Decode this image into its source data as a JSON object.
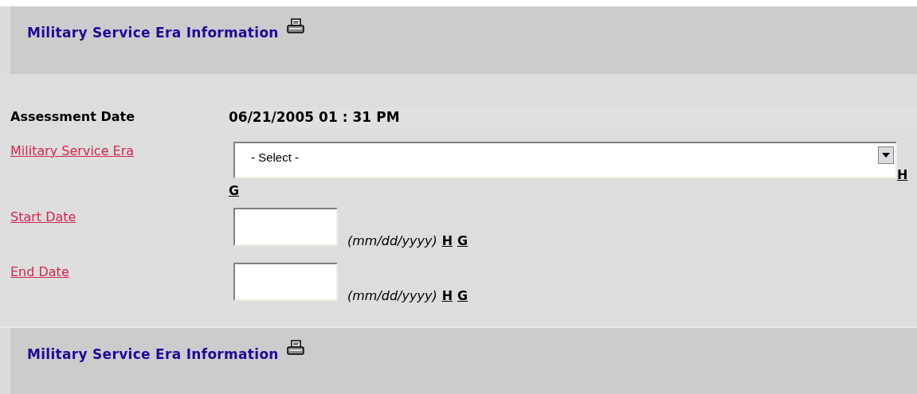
{
  "panels": [
    {
      "title": "Military Service Era Information"
    },
    {
      "title": "Military Service Era Information"
    }
  ],
  "fields": [
    {
      "kind": "readonly",
      "label": "Assessment Date",
      "value_parts": [
        "06/21/2005",
        "01",
        ":",
        "31",
        "PM"
      ]
    },
    {
      "kind": "select",
      "label": "Military Service Era",
      "value": "- Select -",
      "links": [
        "H",
        "G"
      ]
    },
    {
      "kind": "date",
      "label": "Start Date",
      "hint": "(mm/dd/yyyy)",
      "links": [
        "H",
        "G"
      ]
    },
    {
      "kind": "date",
      "label": "End Date",
      "hint": "(mm/dd/yyyy)",
      "links": [
        "H",
        "G"
      ]
    }
  ]
}
